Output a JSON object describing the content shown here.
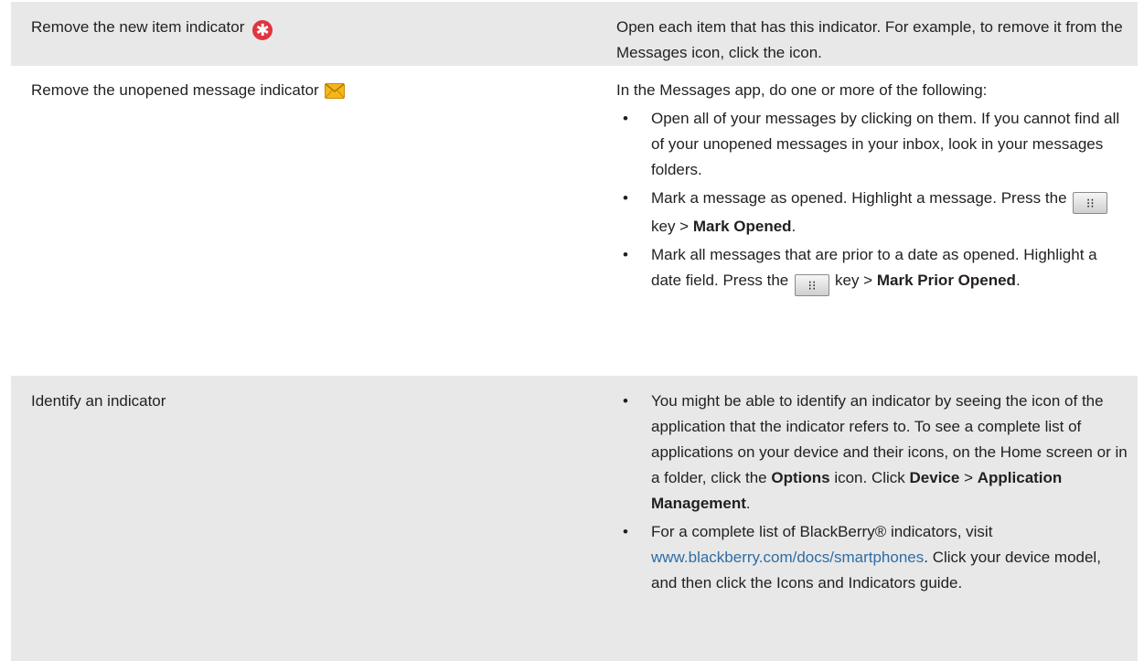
{
  "rows": [
    {
      "task": "Remove the new item indicator",
      "task_icon": "new-item-indicator-icon",
      "description": "Open each item that has this indicator. For example, to remove it from the Messages icon, click the icon."
    },
    {
      "task": "Remove the unopened message indicator",
      "task_icon": "unopened-message-envelope-icon",
      "intro": "In the Messages app, do one or more of the following:",
      "bullets": [
        {
          "text": "Open all of your messages by clicking on them. If you cannot find all of your unopened messages in your inbox, look in your messages folders."
        },
        {
          "text_a": "Mark a message as opened. Highlight a message. Press the",
          "key_icon": "blackberry-menu-key-icon",
          "text_b": "key >",
          "bold": "Mark Opened",
          "end": "."
        },
        {
          "text_a": "Mark all messages that are prior to a date as opened. Highlight a date field. Press the",
          "key_icon": "blackberry-menu-key-icon",
          "text_b": "key >",
          "bold": "Mark Prior Opened",
          "end": "."
        }
      ]
    },
    {
      "task": "Identify an indicator",
      "bullets": [
        {
          "text_a": "You might be able to identify an indicator by seeing the icon of the application that the indicator refers to. To see a complete list of applications on your device and their icons, on the Home screen or in a folder, click the",
          "bold_1": "Options",
          "text_b": "icon. Click",
          "bold_2": "Device",
          "text_c": ">",
          "bold_3": "Application Management",
          "end": "."
        },
        {
          "text_a": "For a complete list of BlackBerry® indicators, visit",
          "link": "www.blackberry.com/docs/smartphones",
          "text_b": ". Click your device model, and then click the Icons and Indicators guide."
        }
      ]
    }
  ],
  "bullet_char": "•",
  "colors": {
    "row_shade": "#e8e8e8",
    "text": "#231f20",
    "link": "#2e6da4",
    "indicator_red": "#e0343f",
    "envelope": "#f6b617"
  }
}
